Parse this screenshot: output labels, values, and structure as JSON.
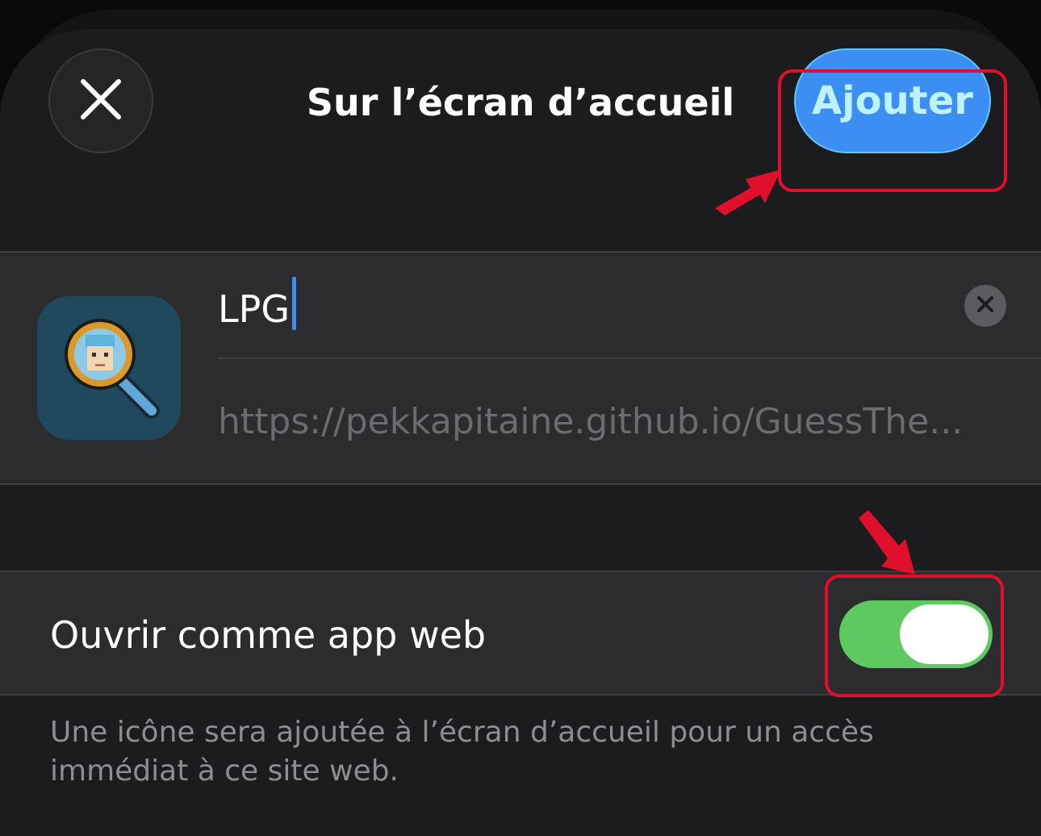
{
  "header": {
    "title": "Sur l’écran d’accueil",
    "add_label": "Ajouter"
  },
  "bookmark": {
    "name_value": "LPG",
    "url": "https://pekkapitaine.github.io/GuessThe..."
  },
  "webapp_row": {
    "label": "Ouvrir comme app web",
    "toggle_on": true
  },
  "footer": {
    "description": "Une icône sera ajoutée à l’écran d’accueil pour un accès immédiat à ce site web."
  },
  "colors": {
    "accent_blue": "#3d8ef3",
    "toggle_green": "#5fc961",
    "annotation_red": "#e0102c"
  },
  "icons": {
    "close": "close-icon",
    "clear": "clear-icon",
    "app": "magnifier-face-icon"
  }
}
